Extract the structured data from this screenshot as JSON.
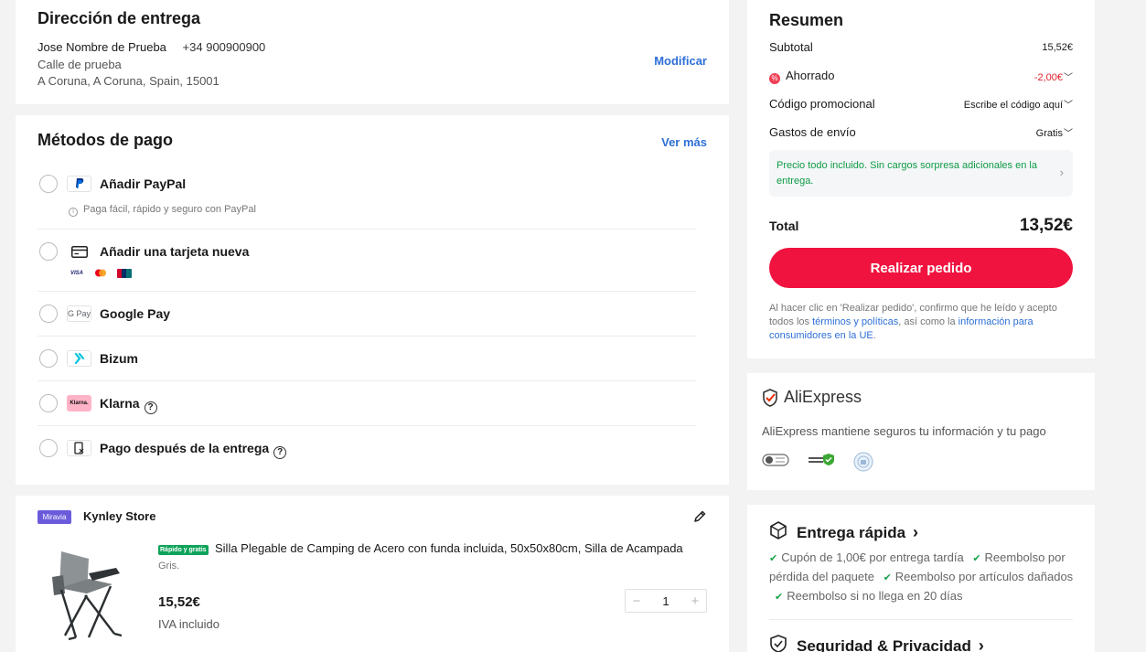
{
  "address": {
    "title": "Dirección de entrega",
    "name": "Jose Nombre de Prueba",
    "phone": "+34 900900900",
    "street": "Calle de prueba",
    "city": "A Coruna, A Coruna, Spain, 15001",
    "modify_label": "Modificar"
  },
  "payment": {
    "title": "Métodos de pago",
    "more_label": "Ver más",
    "methods": [
      {
        "label": "Añadir PayPal",
        "icon": "paypal-icon",
        "sub": "Paga fácil, rápido y seguro con PayPal"
      },
      {
        "label": "Añadir una tarjeta nueva",
        "icon": "credit-card-icon",
        "cards": [
          "VISA",
          "mastercard",
          "UnionPay"
        ]
      },
      {
        "label": "Google Pay",
        "icon": "google-pay-icon",
        "icon_text": "G Pay"
      },
      {
        "label": "Bizum",
        "icon": "bizum-icon"
      },
      {
        "label": "Klarna",
        "icon": "klarna-icon",
        "icon_text": "Klarna."
      },
      {
        "label": "Pago después de la entrega",
        "icon": "cash-on-delivery-icon"
      }
    ]
  },
  "order": {
    "store_badge": "Miravia",
    "store_name": "Kynley Store",
    "fast_badge": "Rápido y gratis",
    "product_title": "Silla Plegable de Camping de Acero con funda incluida, 50x50x80cm, Silla de Acampada",
    "variant": "Gris.",
    "price": "15,52€",
    "vat": "IVA incluido",
    "quantity": "1",
    "qty_minus": "−",
    "qty_plus": "+"
  },
  "summary": {
    "title": "Resumen",
    "subtotal_label": "Subtotal",
    "subtotal_value": "15,52€",
    "saved_label": "Ahorrado",
    "saved_value": "-2,00€",
    "promo_label": "Código promocional",
    "promo_value": "Escribe el código aquí",
    "shipping_label": "Gastos de envío",
    "shipping_value": "Gratis",
    "notice": "Precio todo incluido. Sin cargos sorpresa adicionales en la entrega.",
    "total_label": "Total",
    "total_value": "13,52€",
    "place_order_label": "Realizar pedido",
    "legal_1": "Al hacer clic en 'Realizar pedido', confirmo que he leído y acepto todos los ",
    "legal_link_1": "términos y políticas",
    "legal_2": ", así como la ",
    "legal_link_2": "información para consumidores en la UE",
    "legal_3": "."
  },
  "secure": {
    "logo_text": "AliExpress",
    "desc": "AliExpress mantiene seguros tu información y tu pago"
  },
  "fast_delivery": {
    "title": "Entrega rápida",
    "benefits": [
      "Cupón de 1,00€ por entrega tardía",
      "Reembolso por pérdida del paquete",
      "Reembolso por artículos dañados",
      "Reembolso si no llega en 20 días"
    ],
    "security_title": "Seguridad & Privacidad"
  },
  "colors": {
    "accent": "#f0133f",
    "link": "#2e6fd6",
    "success": "#0f9b45",
    "discount": "#e0212a"
  }
}
